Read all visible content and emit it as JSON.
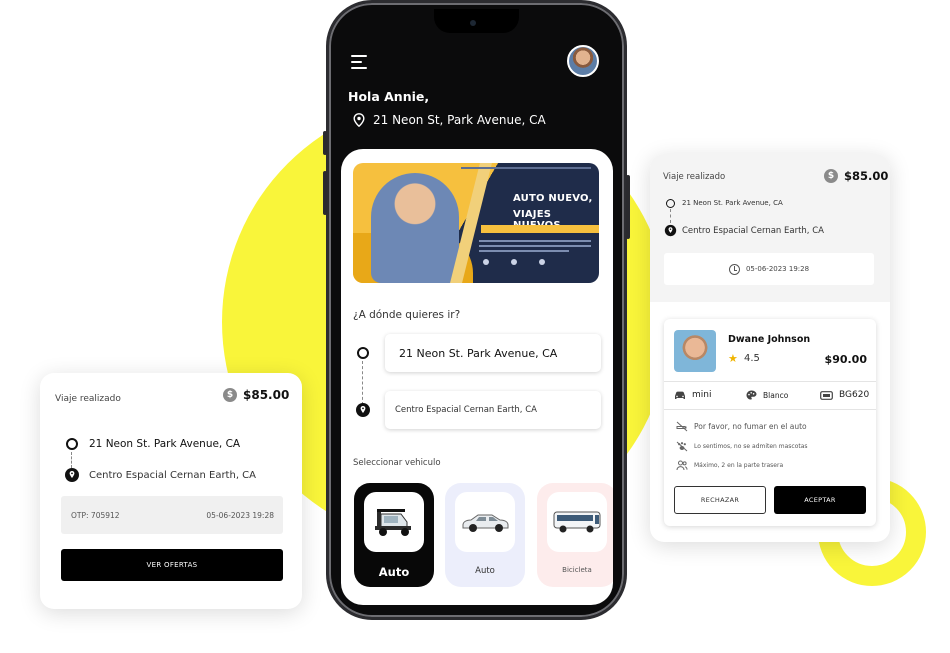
{
  "phone": {
    "greeting": "Hola Annie,",
    "location": "21 Neon St, Park Avenue, CA",
    "banner": {
      "line1": "AUTO NUEVO,",
      "line2": "VIAJES NUEVOS"
    },
    "where_label": "¿A dónde quieres ir?",
    "pickup": "21 Neon St. Park Avenue, CA",
    "dropoff": "Centro Espacial Cernan Earth, CA",
    "select_vehicle_label": "Seleccionar vehiculo",
    "vehicles": [
      {
        "label": "Auto",
        "selected": true
      },
      {
        "label": "Auto",
        "selected": false
      },
      {
        "label": "Bicicleta",
        "selected": false
      }
    ]
  },
  "trip_card_left": {
    "title": "Viaje realizado",
    "price": "$85.00",
    "pickup": "21 Neon St. Park Avenue, CA",
    "dropoff": "Centro Espacial Cernan Earth, CA",
    "otp": "OTP: 705912",
    "datetime": "05-06-2023 19:28",
    "button": "VER OFERTAS"
  },
  "trip_card_right": {
    "title": "Viaje realizado",
    "price": "$85.00",
    "pickup": "21 Neon St. Park Avenue, CA",
    "dropoff": "Centro Espacial Cernan Earth, CA",
    "datetime": "05-06-2023 19:28",
    "offer": {
      "driver_name": "Dwane Johnson",
      "rating": "4.5",
      "fare": "$90.00",
      "car_type": "mini",
      "car_color": "Blanco",
      "plate": "BG620",
      "rules": [
        "Por favor, no fumar en el auto",
        "Lo sentimos, no se admiten mascotas",
        "Máximo, 2 en la parte trasera"
      ],
      "reject_button": "RECHAZAR",
      "accept_button": "ACEPTAR"
    }
  },
  "colors": {
    "accent_yellow": "#f9f53a",
    "dark": "#0b0b0c",
    "star": "#f0b400"
  }
}
